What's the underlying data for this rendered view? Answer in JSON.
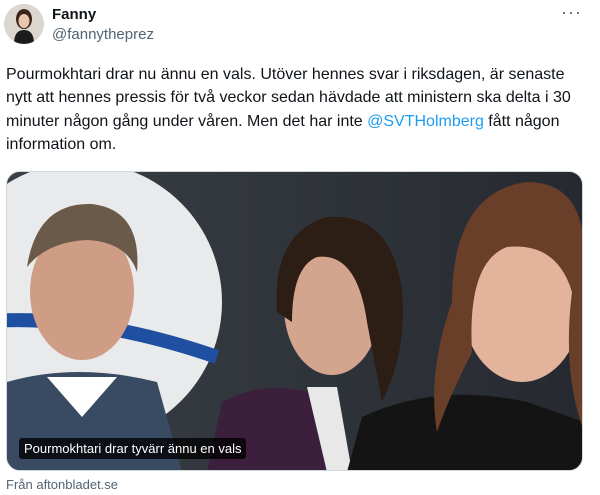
{
  "author": {
    "display_name": "Fanny",
    "handle": "@fannytheprez"
  },
  "more_label": "···",
  "tweet": {
    "text_before": "Pourmokhtari drar nu ännu en vals. Utöver hennes svar i riksdagen, är senaste nytt att hennes pressis för två veckor sedan hävdade att ministern ska delta i 30 minuter någon gång under våren. Men det har inte ",
    "mention": "@SVTHolmberg",
    "text_after": " fått någon information om."
  },
  "card": {
    "caption": "Pourmokhtari drar tyvärr ännu en vals",
    "source": "Från aftonbladet.se"
  },
  "colors": {
    "link": "#1d9bf0",
    "secondary_text": "#536471"
  }
}
